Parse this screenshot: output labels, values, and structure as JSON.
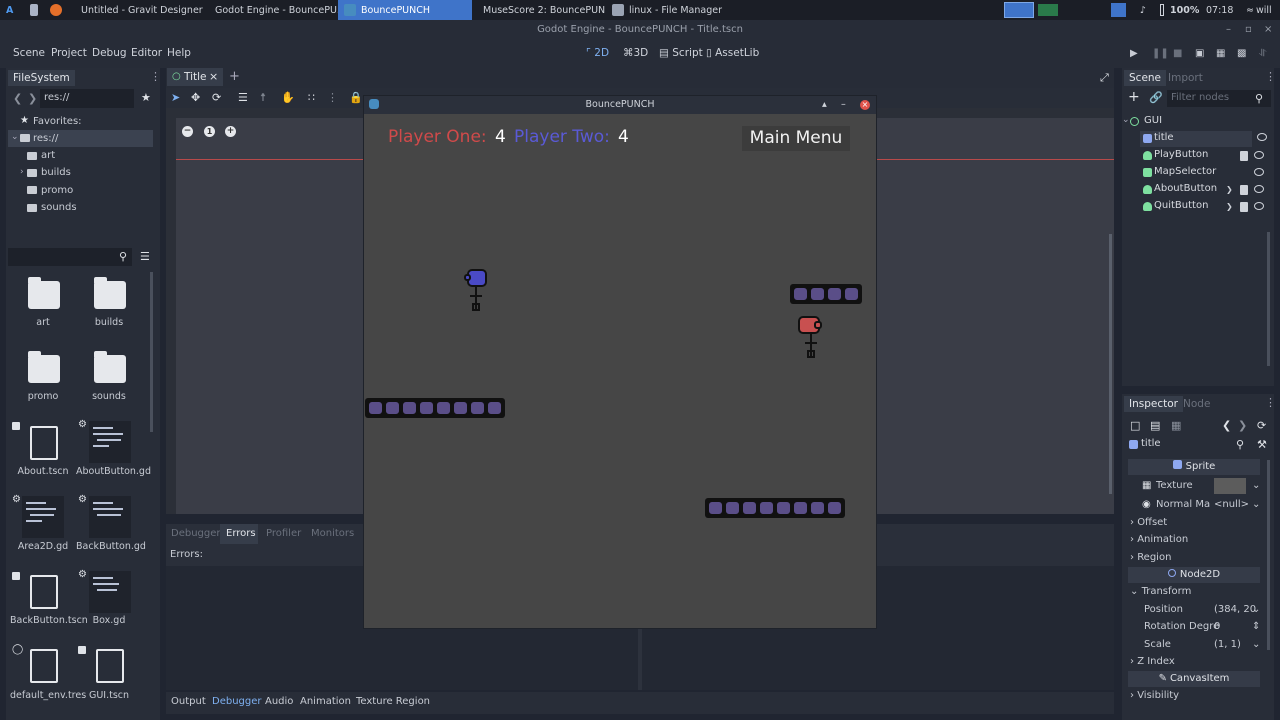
{
  "taskbar": {
    "windows": [
      {
        "label": "Untitled - Gravit Designer -..."
      },
      {
        "label": "Godot Engine - BouncePU..."
      },
      {
        "label": "BouncePUNCH"
      },
      {
        "label": "MuseScore 2: BouncePUN..."
      },
      {
        "label": "linux - File Manager"
      }
    ],
    "battery": "100%",
    "clock": "07:18",
    "user": "will"
  },
  "window_title": "Godot Engine - BouncePUNCH - Title.tscn",
  "menu": {
    "items": [
      "Scene",
      "Project",
      "Debug",
      "Editor",
      "Help"
    ]
  },
  "workspaces": {
    "items": [
      "2D",
      "3D",
      "Script",
      "AssetLib"
    ]
  },
  "filesystem": {
    "tab": "FileSystem",
    "path": "res://",
    "favorites": "Favorites:",
    "root": "res://",
    "folders": [
      "art",
      "builds",
      "promo",
      "sounds"
    ],
    "grid": [
      {
        "name": "art"
      },
      {
        "name": "builds"
      },
      {
        "name": "promo"
      },
      {
        "name": "sounds"
      },
      {
        "name": "About.tscn"
      },
      {
        "name": "AboutButton.gd"
      },
      {
        "name": "Area2D.gd"
      },
      {
        "name": "BackButton.gd"
      },
      {
        "name": "BackButton.tscn"
      },
      {
        "name": "Box.gd"
      },
      {
        "name": "default_env.tres"
      },
      {
        "name": "GUI.tscn"
      }
    ]
  },
  "editor_tab": {
    "label": "Title"
  },
  "scene": {
    "tabs": [
      "Scene",
      "Import"
    ],
    "filter_placeholder": "Filter nodes",
    "nodes": [
      "GUI",
      "title",
      "PlayButton",
      "MapSelector",
      "AboutButton",
      "QuitButton"
    ]
  },
  "inspector": {
    "tabs": [
      "Inspector",
      "Node"
    ],
    "object": "title",
    "sprite_header": "Sprite",
    "texture_label": "Texture",
    "normal_label": "Normal Ma",
    "normal_value": "<null>",
    "sections": [
      "Offset",
      "Animation",
      "Region"
    ],
    "node2d_header": "Node2D",
    "transform": "Transform",
    "position_label": "Position",
    "position_value": "(384, 20",
    "rotation_label": "Rotation Degre",
    "rotation_value": "0",
    "scale_label": "Scale",
    "scale_value": "(1, 1)",
    "zindex": "Z Index",
    "canvasitem_header": "CanvasItem",
    "visibility": "Visibility"
  },
  "game": {
    "title": "BouncePUNCH",
    "p1_label": "Player One:",
    "p1_score": "4",
    "p2_label": "Player Two:",
    "p2_score": "4",
    "menu_button": "Main Menu"
  },
  "bottom": {
    "tabs": [
      "Debugger",
      "Errors",
      "Profiler",
      "Monitors"
    ],
    "errors_label": "Errors:",
    "status_tabs": [
      "Output",
      "Debugger",
      "Audio",
      "Animation",
      "Texture Region"
    ]
  },
  "colors": {
    "accent": "#3f74c9",
    "p1": "#d04a4a",
    "p2": "#5a5ad6"
  }
}
